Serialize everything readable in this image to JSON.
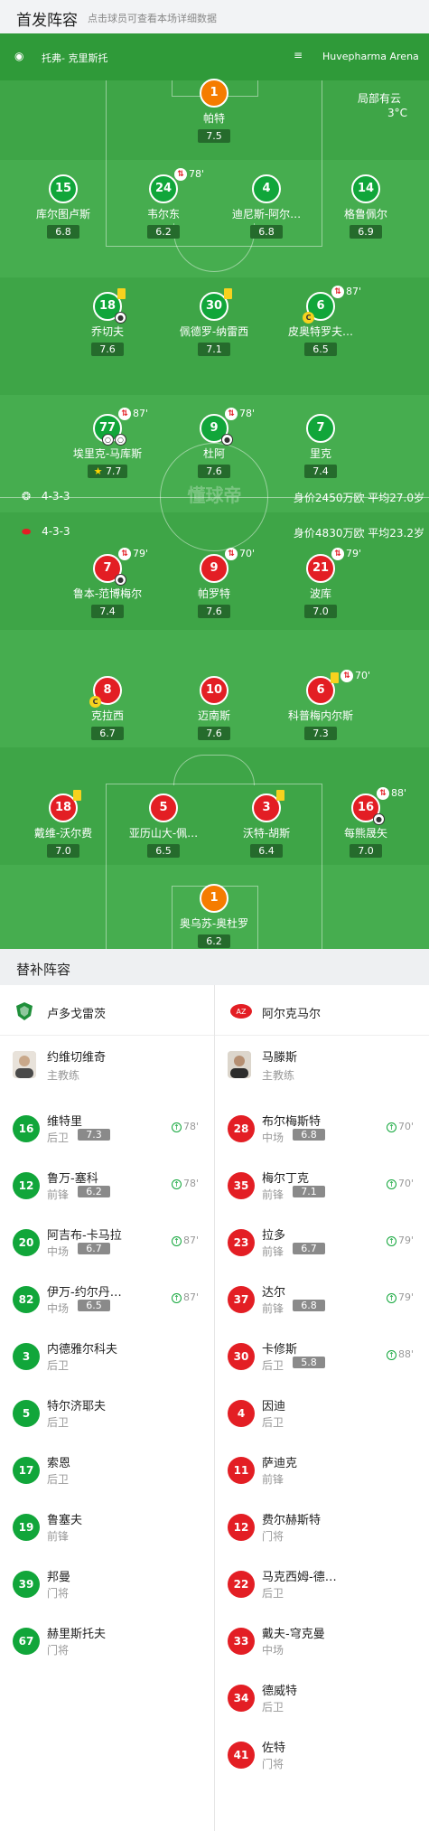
{
  "header": {
    "title": "首发阵容",
    "subtitle": "点击球员可查看本场详细数据"
  },
  "match": {
    "city": "托弗- 克里斯托",
    "stadium": "Huvepharma Arena",
    "weather": "局部有云",
    "temperature": "3°C"
  },
  "pitch_watermark": "懂球帝",
  "home": {
    "formation": "4-3-3",
    "value_info": "身价2450万欧 平均27.0岁",
    "players": [
      {
        "number": "1",
        "name": "帕特",
        "rating": "7.5"
      },
      {
        "number": "15",
        "name": "库尔图卢斯",
        "rating": "6.8"
      },
      {
        "number": "24",
        "name": "韦尔东",
        "rating": "6.2",
        "sub_minute": "78'"
      },
      {
        "number": "4",
        "name": "迪尼斯-阿尔…",
        "rating": "6.8"
      },
      {
        "number": "14",
        "name": "格鲁佩尔",
        "rating": "6.9"
      },
      {
        "number": "18",
        "name": "乔切夫",
        "rating": "7.6"
      },
      {
        "number": "30",
        "name": "佩德罗-纳雷西",
        "rating": "7.1"
      },
      {
        "number": "6",
        "name": "皮奥特罗夫…",
        "rating": "6.5",
        "sub_minute": "87'"
      },
      {
        "number": "77",
        "name": "埃里克-马库斯",
        "rating": "7.7",
        "sub_minute": "87'"
      },
      {
        "number": "9",
        "name": "杜阿",
        "rating": "7.6",
        "sub_minute": "78'"
      },
      {
        "number": "7",
        "name": "里克",
        "rating": "7.4"
      }
    ]
  },
  "away": {
    "formation": "4-3-3",
    "value_info": "身价4830万欧 平均23.2岁",
    "players": [
      {
        "number": "7",
        "name": "鲁本-范博梅尔",
        "rating": "7.4",
        "sub_minute": "79'"
      },
      {
        "number": "9",
        "name": "帕罗特",
        "rating": "7.6",
        "sub_minute": "70'"
      },
      {
        "number": "21",
        "name": "波库",
        "rating": "7.0",
        "sub_minute": "79'"
      },
      {
        "number": "8",
        "name": "克拉西",
        "rating": "6.7"
      },
      {
        "number": "10",
        "name": "迈南斯",
        "rating": "7.6"
      },
      {
        "number": "6",
        "name": "科普梅内尔斯",
        "rating": "7.3",
        "sub_minute": "70'"
      },
      {
        "number": "18",
        "name": "戴维-沃尔费",
        "rating": "7.0"
      },
      {
        "number": "5",
        "name": "亚历山大-佩…",
        "rating": "6.5"
      },
      {
        "number": "3",
        "name": "沃特-胡斯",
        "rating": "6.4"
      },
      {
        "number": "16",
        "name": "每熊晟矢",
        "rating": "7.0",
        "sub_minute": "88'"
      },
      {
        "number": "1",
        "name": "奥乌苏-奥杜罗",
        "rating": "6.2"
      }
    ]
  },
  "bench": {
    "title": "替补阵容",
    "home_team": "卢多戈雷茨",
    "away_team": "阿尔克马尔",
    "home_coach": {
      "name": "约维切维奇",
      "role": "主教练"
    },
    "away_coach": {
      "name": "马滕斯",
      "role": "主教练"
    },
    "home_subs": [
      {
        "number": "16",
        "name": "维特里",
        "pos": "后卫",
        "rating": "7.3",
        "minute": "78'"
      },
      {
        "number": "12",
        "name": "鲁万-塞科",
        "pos": "前锋",
        "rating": "6.2",
        "minute": "78'"
      },
      {
        "number": "20",
        "name": "阿吉布-卡马拉",
        "pos": "中场",
        "rating": "6.7",
        "minute": "87'"
      },
      {
        "number": "82",
        "name": "伊万-约尔丹…",
        "pos": "中场",
        "rating": "6.5",
        "minute": "87'"
      },
      {
        "number": "3",
        "name": "内德雅尔科夫",
        "pos": "后卫"
      },
      {
        "number": "5",
        "name": "特尔济耶夫",
        "pos": "后卫"
      },
      {
        "number": "17",
        "name": "索恩",
        "pos": "后卫"
      },
      {
        "number": "19",
        "name": "鲁塞夫",
        "pos": "前锋"
      },
      {
        "number": "39",
        "name": "邦曼",
        "pos": "门将"
      },
      {
        "number": "67",
        "name": "赫里斯托夫",
        "pos": "门将"
      }
    ],
    "away_subs": [
      {
        "number": "28",
        "name": "布尔梅斯特",
        "pos": "中场",
        "rating": "6.8",
        "minute": "70'"
      },
      {
        "number": "35",
        "name": "梅尔丁克",
        "pos": "前锋",
        "rating": "7.1",
        "minute": "70'"
      },
      {
        "number": "23",
        "name": "拉多",
        "pos": "前锋",
        "rating": "6.7",
        "minute": "79'"
      },
      {
        "number": "37",
        "name": "达尔",
        "pos": "前锋",
        "rating": "6.8",
        "minute": "79'"
      },
      {
        "number": "30",
        "name": "卡修斯",
        "pos": "后卫",
        "rating": "5.8",
        "minute": "88'"
      },
      {
        "number": "4",
        "name": "因迪",
        "pos": "后卫"
      },
      {
        "number": "11",
        "name": "萨迪克",
        "pos": "前锋"
      },
      {
        "number": "12",
        "name": "费尔赫斯特",
        "pos": "门将"
      },
      {
        "number": "22",
        "name": "马克西姆-德…",
        "pos": "后卫"
      },
      {
        "number": "33",
        "name": "戴夫-穹克曼",
        "pos": "中场"
      },
      {
        "number": "34",
        "name": "德威特",
        "pos": "后卫"
      },
      {
        "number": "41",
        "name": "佐特",
        "pos": "门将"
      }
    ]
  }
}
